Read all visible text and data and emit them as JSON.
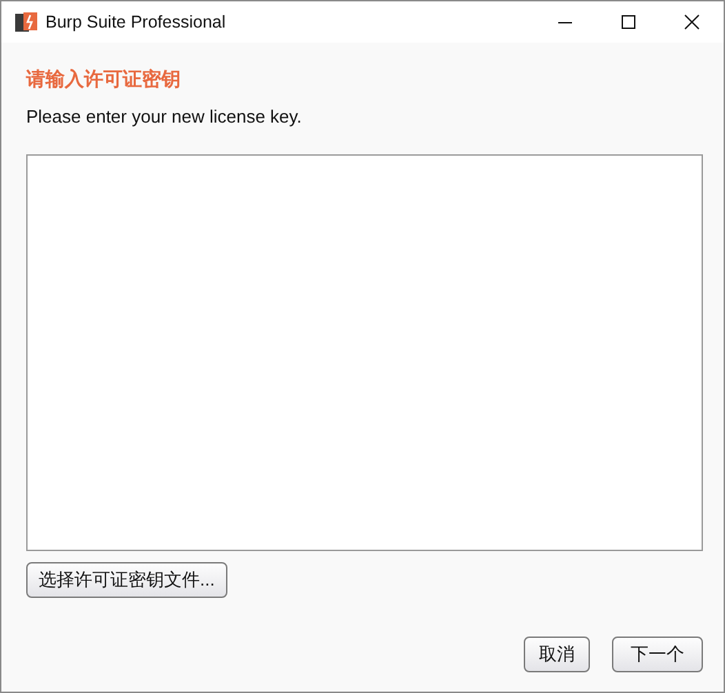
{
  "window": {
    "title": "Burp Suite Professional"
  },
  "heading": "请输入许可证密钥",
  "instruction": "Please enter your new license key.",
  "file_button": "选择许可证密钥文件...",
  "buttons": [
    {
      "label": "取消"
    },
    {
      "label": "下一个"
    }
  ]
}
